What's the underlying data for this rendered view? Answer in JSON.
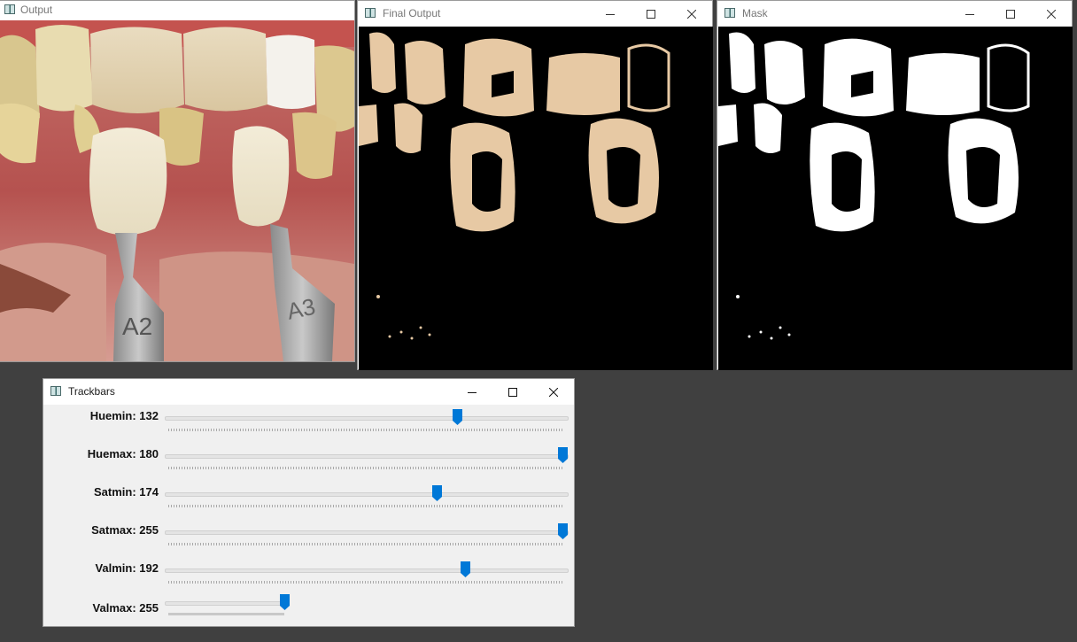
{
  "windows": {
    "output": {
      "title": "Output"
    },
    "final": {
      "title": "Final Output"
    },
    "mask": {
      "title": "Mask"
    },
    "trackbars": {
      "title": "Trackbars"
    }
  },
  "photo": {
    "shade_labels": [
      "A2",
      "A3"
    ]
  },
  "trackbars": [
    {
      "label": "Huemin: 132",
      "value": 132,
      "max": 180
    },
    {
      "label": "Huemax: 180",
      "value": 180,
      "max": 180
    },
    {
      "label": "Satmin: 174",
      "value": 174,
      "max": 255
    },
    {
      "label": "Satmax: 255",
      "value": 255,
      "max": 255
    },
    {
      "label": "Valmin: 192",
      "value": 192,
      "max": 255
    },
    {
      "label": "Valmax: 255",
      "value": 255,
      "max": 255
    }
  ],
  "colors": {
    "accent": "#0078d7",
    "desktop": "#404040"
  }
}
